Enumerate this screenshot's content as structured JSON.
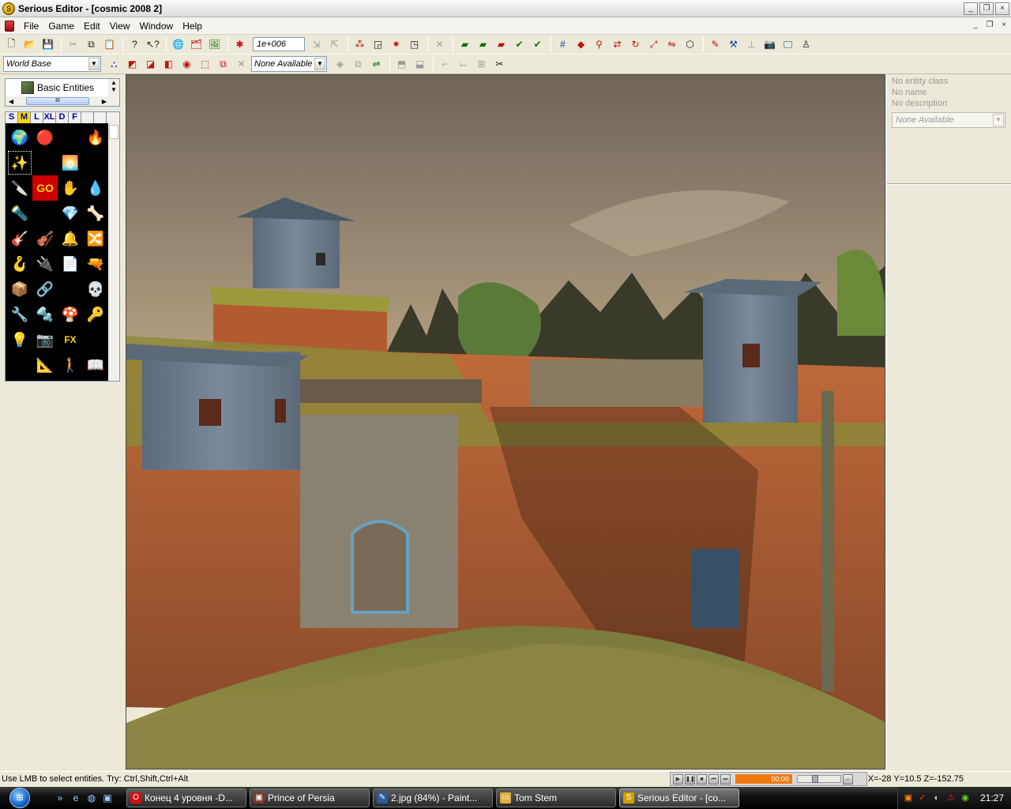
{
  "window": {
    "title": "Serious Editor - [cosmic 2008 2]",
    "app_icon": "S",
    "buttons": [
      "_",
      "❐",
      "×"
    ]
  },
  "menu": {
    "items": [
      "File",
      "Game",
      "Edit",
      "View",
      "Window",
      "Help"
    ],
    "mdi_buttons": [
      "_",
      "❐",
      "×"
    ]
  },
  "toolbar1": {
    "grid_size_value": "1e+006",
    "icons": [
      "new-file-icon",
      "open-file-icon",
      "save-icon",
      "cut-icon",
      "copy-icon",
      "paste-icon",
      "help-icon",
      "context-help-icon",
      "globe-icon",
      "browse-icon",
      "texture-icon",
      "entity-icon",
      "grid-size-icon",
      "snap-icon",
      "sprite-icon",
      "csg-icon",
      "portal-icon",
      "scissors-icon",
      "layer-icon"
    ]
  },
  "toolbar2": {
    "world_base_value": "World Base",
    "primitive_value": "None Available"
  },
  "left_panel": {
    "tree_node_label": "Basic Entities",
    "hscroll_thumb": "III",
    "size_tabs": [
      "S",
      "M",
      "L",
      "XL",
      "D",
      "F",
      "",
      ""
    ],
    "active_size_tab": 1,
    "entities": [
      {
        "icon": "🌍",
        "name": "world-entity-icon"
      },
      {
        "icon": "🔴",
        "name": "marker-entity-icon"
      },
      {
        "icon": "👁",
        "name": "eye-entity-icon"
      },
      {
        "icon": "🔥",
        "name": "fire-entity-icon"
      },
      {
        "icon": "✨",
        "name": "light-entity-icon"
      },
      {
        "icon": "⛰",
        "name": "terrain-entity-icon"
      },
      {
        "icon": "🌅",
        "name": "sky-entity-icon"
      },
      {
        "icon": "❄",
        "name": "weather-entity-icon"
      },
      {
        "icon": "🔪",
        "name": "knife-entity-icon"
      },
      {
        "icon": "GO",
        "name": "go-entity-icon"
      },
      {
        "icon": "✋",
        "name": "hand-entity-icon"
      },
      {
        "icon": "💧",
        "name": "drop-entity-icon"
      },
      {
        "icon": "🔦",
        "name": "flashlight-entity-icon"
      },
      {
        "icon": "↕",
        "name": "arrows-entity-icon"
      },
      {
        "icon": "💎",
        "name": "crystal-entity-icon"
      },
      {
        "icon": "🦴",
        "name": "bone-entity-icon"
      },
      {
        "icon": "🎸",
        "name": "sound-entity-icon"
      },
      {
        "icon": "🎻",
        "name": "music-entity-icon"
      },
      {
        "icon": "🔔",
        "name": "bell-entity-icon"
      },
      {
        "icon": "🔀",
        "name": "switch-entity-icon"
      },
      {
        "icon": "🪝",
        "name": "hook-entity-icon"
      },
      {
        "icon": "🔌",
        "name": "plug-entity-icon"
      },
      {
        "icon": "📄",
        "name": "document-entity-icon"
      },
      {
        "icon": "🔫",
        "name": "gun-entity-icon"
      },
      {
        "icon": "📦",
        "name": "box-entity-icon"
      },
      {
        "icon": "🔗",
        "name": "link-entity-icon"
      },
      {
        "icon": "❤",
        "name": "heart-entity-icon"
      },
      {
        "icon": "💀",
        "name": "skull-entity-icon"
      },
      {
        "icon": "🔧",
        "name": "wrench-entity-icon"
      },
      {
        "icon": "🔩",
        "name": "bolt-entity-icon"
      },
      {
        "icon": "🍄",
        "name": "mushroom-entity-icon"
      },
      {
        "icon": "🔑",
        "name": "key-entity-icon"
      },
      {
        "icon": "💡",
        "name": "lamp-entity-icon"
      },
      {
        "icon": "📷",
        "name": "camera-entity-icon"
      },
      {
        "icon": "FX",
        "name": "fx-entity-icon"
      },
      {
        "icon": "🌡",
        "name": "thermometer-entity-icon"
      },
      {
        "icon": "↗",
        "name": "direction-entity-icon"
      },
      {
        "icon": "📐",
        "name": "ruler-entity-icon"
      },
      {
        "icon": "🚶",
        "name": "walker-entity-icon"
      },
      {
        "icon": "📖",
        "name": "book-entity-icon"
      }
    ]
  },
  "right_panel": {
    "entity_class": "No entity class",
    "name": "No name",
    "description": "No description",
    "combo_value": "None Available"
  },
  "status": {
    "text": "Use LMB to select entities. Try: Ctrl,Shift,Ctrl+Alt",
    "coords": "X=-28 Y=10.5 Z=-152.75",
    "media_time": "00:00"
  },
  "taskbar": {
    "tasks": [
      {
        "label": "Конец 4 уровня -D...",
        "icon": "O",
        "color": "#d01010"
      },
      {
        "label": "Prince of Persia",
        "icon": "▣",
        "color": "#7a3a2a"
      },
      {
        "label": "2.jpg (84%) - Paint...",
        "icon": "✎",
        "color": "#2a5aa0"
      },
      {
        "label": "Tom Stem",
        "icon": "▭",
        "color": "#e0b040"
      },
      {
        "label": "Serious Editor - [co...",
        "icon": "S",
        "color": "#d4a000"
      }
    ],
    "clock": "21:27"
  },
  "colors": {
    "chrome": "#ece9d8",
    "sky": "#8a7a68",
    "grass": "#8a8a40",
    "cliff": "#b05a30",
    "wood": "#6a7a8a"
  }
}
